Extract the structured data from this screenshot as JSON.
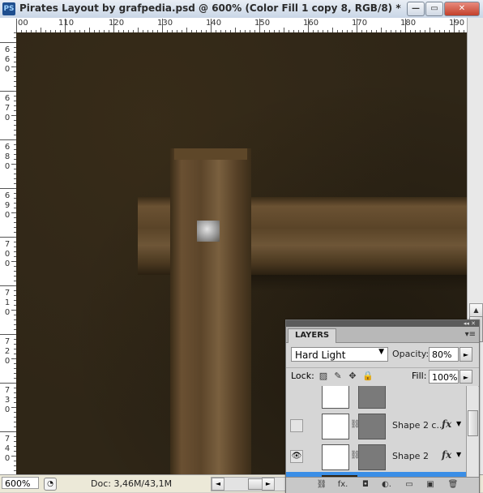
{
  "window": {
    "app_icon": "PS",
    "title": "Pirates Layout by grafpedia.psd @ 600% (Color Fill 1 copy 8, RGB/8) *",
    "minimize": "—",
    "restore": "▭",
    "close": "✕"
  },
  "ruler": {
    "h_labels": [
      "00",
      "110",
      "120",
      "130",
      "140",
      "150",
      "160",
      "170",
      "180",
      "190"
    ],
    "v_labels": [
      "660",
      "670",
      "680",
      "690",
      "700",
      "710",
      "720",
      "730",
      "740"
    ]
  },
  "scrollbar_glyphs": {
    "up": "▲",
    "down": "▼",
    "left": "◄",
    "right": "►"
  },
  "status": {
    "zoom": "600%",
    "zoom_icon": "◔",
    "doc": "Doc: 3,46M/43,1M",
    "doc_arrow": "►"
  },
  "layers_panel": {
    "top_icons": "◂◂ ✕",
    "tab": "LAYERS",
    "menu": "▾≡",
    "blend_mode": "Hard Light",
    "blend_arrow": "▼",
    "opacity_label": "Opacity:",
    "opacity_value": "80%",
    "fill_label": "Fill:",
    "fill_value": "100%",
    "lock_label": "Lock:",
    "lock_icons": [
      "▨",
      "✎",
      "✥",
      "🔒"
    ],
    "layers": [
      {
        "name": "Shape 2 c...",
        "visible": false,
        "fx": "fx"
      },
      {
        "name": "Shape 2",
        "visible": true,
        "fx": "fx"
      }
    ],
    "eye_glyph": "👁",
    "chain_glyph": "⛓",
    "bottom_icons": [
      "⛓",
      "fx.",
      "◘",
      "◐.",
      "▭",
      "▣",
      "🗑"
    ]
  },
  "colors": {
    "canvas_bg": "#2f2617",
    "wood": "#6b5233",
    "selection": "#3a8ee6"
  }
}
